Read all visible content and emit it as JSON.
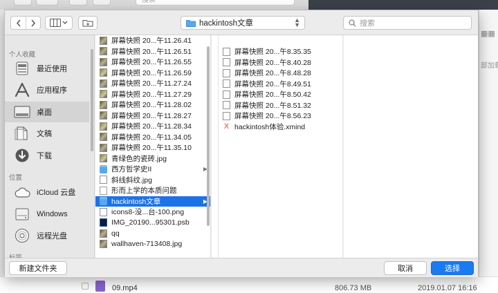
{
  "background": {
    "search_placeholder": "搜索",
    "side_label": "部加载",
    "row": {
      "name": "09.mp4",
      "size": "806.73 MB",
      "date": "2019.01.07 16:16"
    }
  },
  "toolbar": {
    "location_label": "hackintosh文章",
    "search_placeholder": "搜索"
  },
  "sidebar": {
    "sections": {
      "favorites": "个人收藏",
      "locations": "位置",
      "tags": "标签"
    },
    "favorites": [
      {
        "label": "最近使用",
        "icon": "recents-icon"
      },
      {
        "label": "应用程序",
        "icon": "applications-icon"
      },
      {
        "label": "桌面",
        "icon": "desktop-icon",
        "selected": true
      },
      {
        "label": "文稿",
        "icon": "documents-icon"
      },
      {
        "label": "下载",
        "icon": "downloads-icon"
      }
    ],
    "locations": [
      {
        "label": "iCloud 云盘",
        "icon": "cloud-icon"
      },
      {
        "label": "Windows",
        "icon": "drive-icon"
      },
      {
        "label": "远程光盘",
        "icon": "disc-icon"
      }
    ]
  },
  "column1": [
    {
      "name": "屏幕快照 20...午11.26.41",
      "kind": "thumb"
    },
    {
      "name": "屏幕快照 20...午11.26.51",
      "kind": "thumb"
    },
    {
      "name": "屏幕快照 20...午11.26.55",
      "kind": "thumb"
    },
    {
      "name": "屏幕快照 20...午11.26.59",
      "kind": "thumb2"
    },
    {
      "name": "屏幕快照 20...午11.27.24",
      "kind": "thumb"
    },
    {
      "name": "屏幕快照 20...午11.27.29",
      "kind": "thumb2"
    },
    {
      "name": "屏幕快照 20...午11.28.02",
      "kind": "thumb"
    },
    {
      "name": "屏幕快照 20...午11.28.27",
      "kind": "thumb"
    },
    {
      "name": "屏幕快照 20...午11.28.34",
      "kind": "thumb2"
    },
    {
      "name": "屏幕快照 20...午11.34.05",
      "kind": "thumb"
    },
    {
      "name": "屏幕快照 20...午11.35.10",
      "kind": "thumb"
    },
    {
      "name": "青绿色的瓷砖.jpg",
      "kind": "thumb2"
    },
    {
      "name": "西方哲学史II",
      "kind": "folder",
      "has_children": true
    },
    {
      "name": "斜线斜纹.jpg",
      "kind": "thumbw"
    },
    {
      "name": "形而上学的本质问题",
      "kind": "doc"
    },
    {
      "name": "hackintosh文章",
      "kind": "folder",
      "has_children": true,
      "selected": true
    },
    {
      "name": "icons8-没...台-100.png",
      "kind": "thumbw"
    },
    {
      "name": "IMG_20190...95301.psb",
      "kind": "psb"
    },
    {
      "name": "qq",
      "kind": "thumb"
    },
    {
      "name": "wallhaven-713408.jpg",
      "kind": "thumb"
    }
  ],
  "column2": [
    {
      "name": "屏幕快照 20...午8.35.35",
      "kind": "thumbw"
    },
    {
      "name": "屏幕快照 20...午8.40.28",
      "kind": "thumbw"
    },
    {
      "name": "屏幕快照 20...午8.48.28",
      "kind": "thumbw"
    },
    {
      "name": "屏幕快照 20...午8.49.51",
      "kind": "thumbw"
    },
    {
      "name": "屏幕快照 20...午8.50.42",
      "kind": "thumbw"
    },
    {
      "name": "屏幕快照 20...午8.51.32",
      "kind": "thumbw"
    },
    {
      "name": "屏幕快照 20...午8.56.23",
      "kind": "thumbw"
    },
    {
      "name": "hackintosh体验.xmind",
      "kind": "xmind"
    }
  ],
  "footer": {
    "new_folder": "新建文件夹",
    "cancel": "取消",
    "choose": "选择"
  },
  "colors": {
    "accent": "#1d72e8",
    "primary_button": "#1a7af0"
  }
}
